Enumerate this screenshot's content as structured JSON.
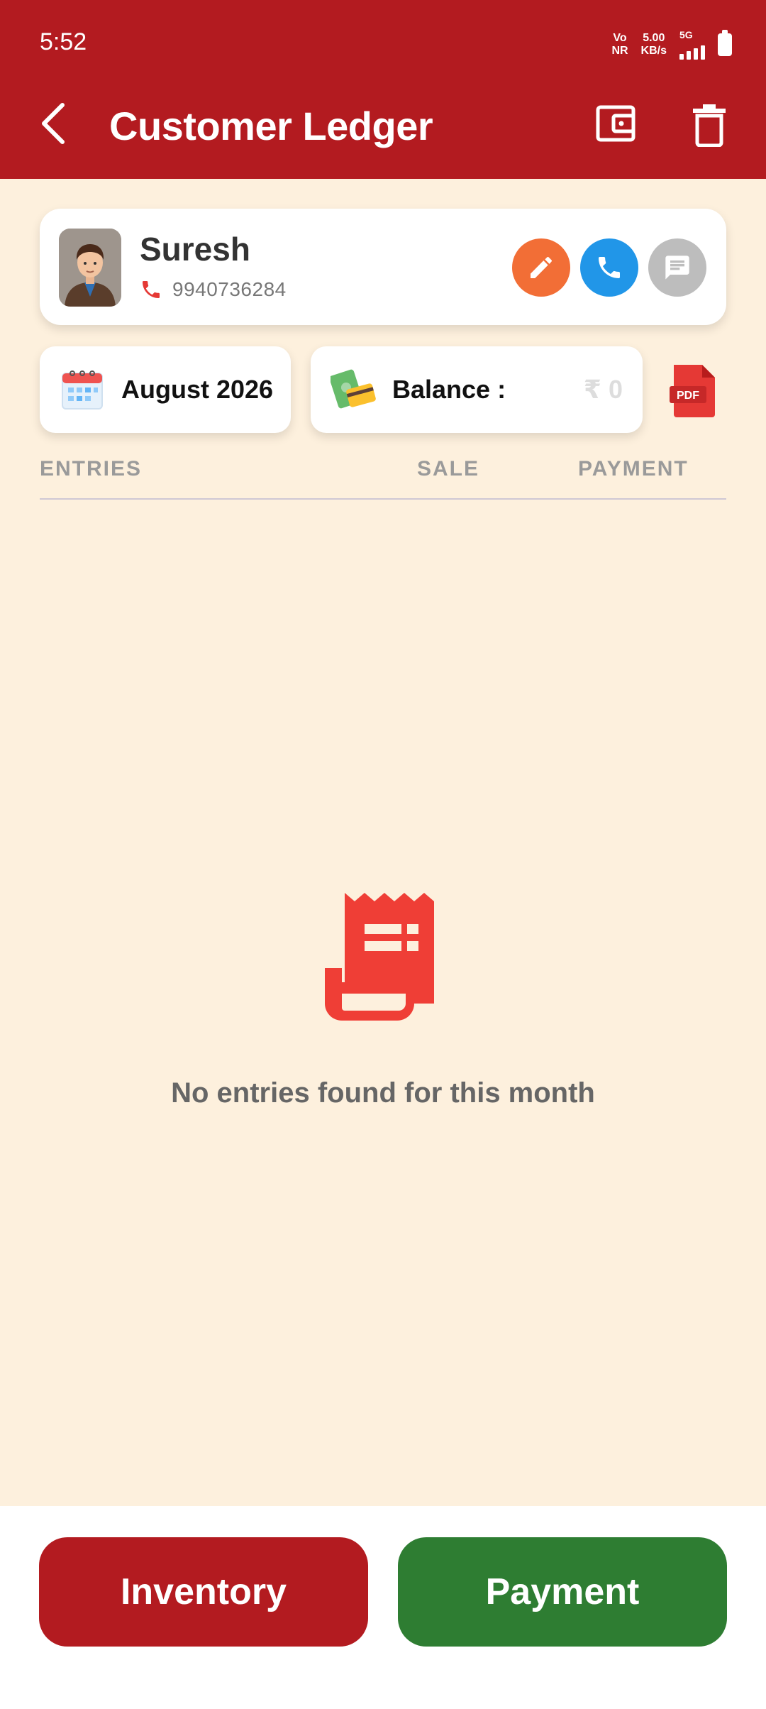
{
  "status_bar": {
    "time": "5:52",
    "network_top": "Vo",
    "network_bottom": "NR",
    "speed_top": "5.00",
    "speed_bottom": "KB/s",
    "signal_label": "5G"
  },
  "header": {
    "title": "Customer Ledger",
    "icons": [
      "back-arrow-icon",
      "wallet-icon",
      "trash-icon"
    ]
  },
  "customer": {
    "name": "Suresh",
    "phone": "9940736284",
    "actions": [
      "edit-icon",
      "phone-icon",
      "message-icon"
    ]
  },
  "filters": {
    "month": "August 2026",
    "balance_label": "Balance :",
    "balance_value": "₹ 0",
    "pdf_label": "PDF"
  },
  "table": {
    "columns": [
      "ENTRIES",
      "SALE",
      "PAYMENT"
    ]
  },
  "empty_state": {
    "message": "No entries found for this month"
  },
  "actions": {
    "inventory_label": "Inventory",
    "payment_label": "Payment"
  },
  "colors": {
    "primary": "#b31b20",
    "background": "#fdf0dd",
    "success": "#2e7d32",
    "edit": "#f26e36",
    "call": "#2196e8",
    "message": "#bdbdbd"
  }
}
